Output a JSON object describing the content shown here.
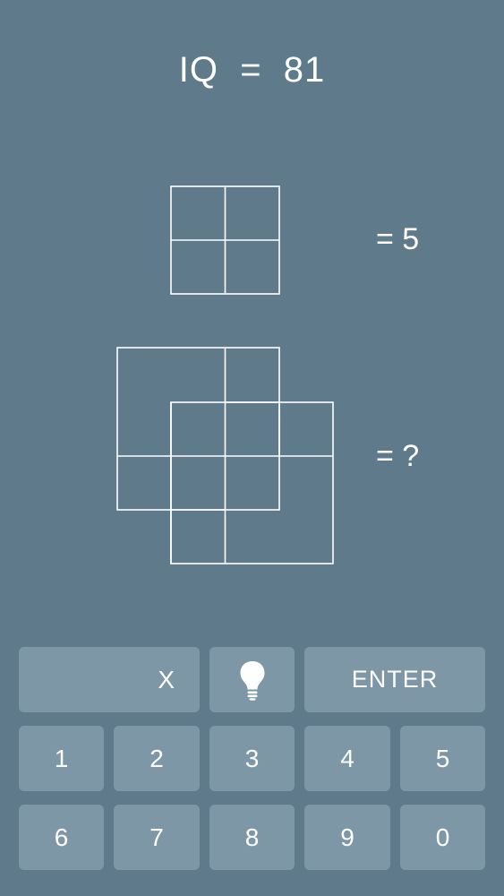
{
  "header": {
    "title": "IQ  =  81"
  },
  "puzzle": {
    "example_answer": "= 5",
    "question_answer": "= ?"
  },
  "keypad": {
    "clear_label": "X",
    "hint_icon": "lightbulb-icon",
    "enter_label": "ENTER",
    "digits": [
      "1",
      "2",
      "3",
      "4",
      "5",
      "6",
      "7",
      "8",
      "9",
      "0"
    ]
  },
  "colors": {
    "background": "#5f7a8b",
    "key": "#7d97a6",
    "line": "#ffffff"
  }
}
